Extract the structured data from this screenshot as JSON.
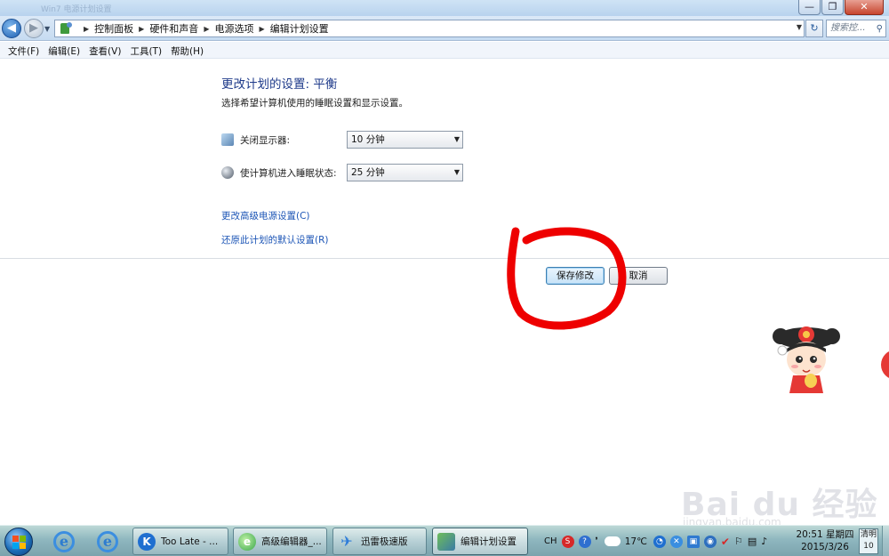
{
  "window": {
    "ghost_title": "Win7 电源计划设置",
    "minimize": "—",
    "maximize": "❐",
    "close": "✕"
  },
  "address": {
    "breadcrumbs": [
      "控制面板",
      "硬件和声音",
      "电源选项",
      "编辑计划设置"
    ],
    "search_placeholder": "搜索控..."
  },
  "menu": [
    "文件(F)",
    "编辑(E)",
    "查看(V)",
    "工具(T)",
    "帮助(H)"
  ],
  "content": {
    "heading": "更改计划的设置: 平衡",
    "subtext": "选择希望计算机使用的睡眠设置和显示设置。",
    "settings": [
      {
        "label": "关闭显示器:",
        "value": "10 分钟",
        "icon": "monitor-icon"
      },
      {
        "label": "使计算机进入睡眠状态:",
        "value": "25 分钟",
        "icon": "moon-icon"
      }
    ],
    "links": [
      "更改高级电源设置(C)",
      "还原此计划的默认设置(R)"
    ],
    "save_button": "保存修改",
    "cancel_button": "取消"
  },
  "watermark": {
    "logo": "Bai du 经验",
    "url": "jingyan.baidu.com"
  },
  "taskbar": {
    "tasks": [
      "Too Late - ...",
      "高级编辑器_...",
      "迅雷极速版",
      "编辑计划设置"
    ],
    "tray": {
      "lang": "CH",
      "temperature": "17℃"
    },
    "clock": {
      "time": "20:51 星期四",
      "date": "2015/3/26"
    },
    "weather": {
      "label": "清明",
      "day": "10"
    }
  },
  "colors": {
    "heading": "#1e3a8a",
    "link": "#1c55b6",
    "annotation_red": "#ee0000"
  }
}
